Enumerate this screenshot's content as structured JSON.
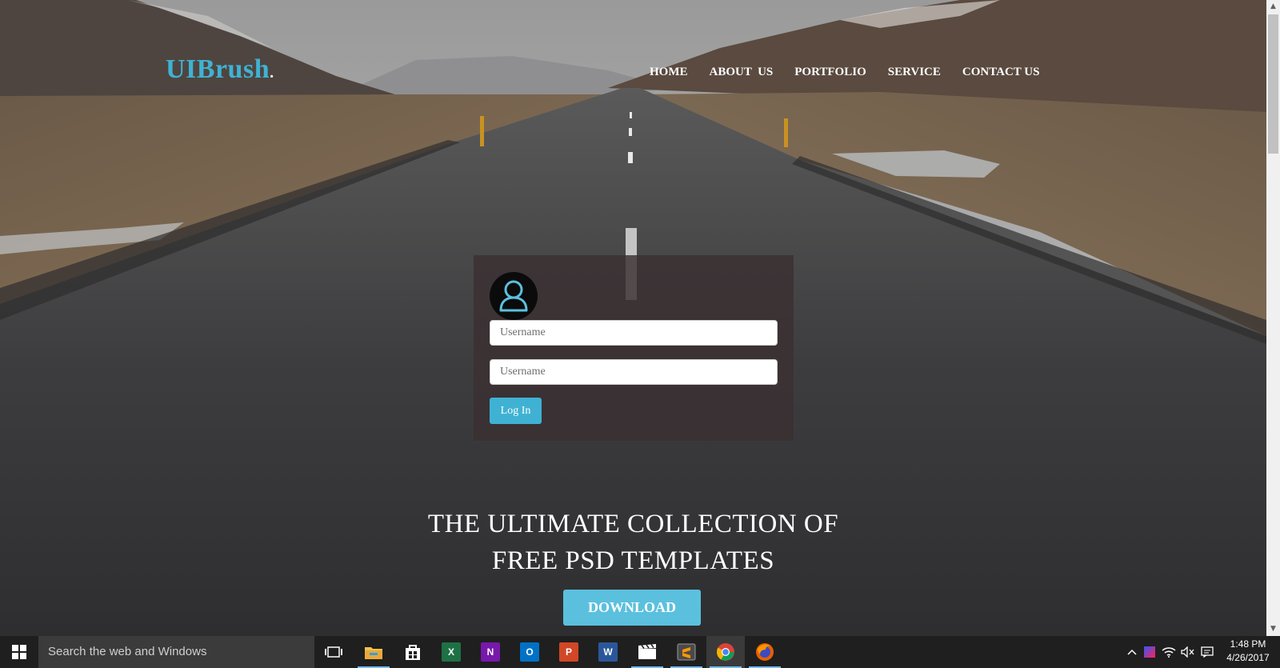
{
  "header": {
    "logo_text": "UIBrush",
    "logo_dot": ".",
    "nav": [
      "HOME",
      "ABOUT  US",
      "PORTFOLIO",
      "SERVICE",
      "CONTACT US"
    ]
  },
  "login": {
    "field1_placeholder": "Username",
    "field2_placeholder": "Username",
    "button_label": "Log In"
  },
  "hero": {
    "line1": "THE ULTIMATE COLLECTION OF",
    "line2": "FREE PSD TEMPLATES",
    "download_label": "DOWNLOAD"
  },
  "taskbar": {
    "search_placeholder": "Search the web and Windows",
    "apps": [
      "task-view",
      "file-explorer",
      "store",
      "excel",
      "onenote",
      "outlook",
      "powerpoint",
      "word",
      "movie-maker",
      "sublime-text",
      "chrome",
      "firefox"
    ],
    "time": "1:48 PM",
    "date": "4/26/2017"
  },
  "colors": {
    "accent": "#3fb2d3",
    "download": "#5bc0de",
    "panel": "#3a3032",
    "taskbar": "#1f1f1f"
  }
}
